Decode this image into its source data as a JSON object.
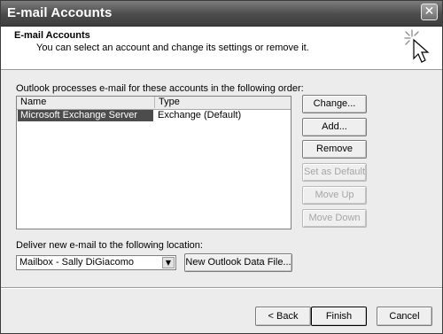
{
  "window": {
    "title": "E-mail Accounts",
    "close_glyph": "✕"
  },
  "header": {
    "title": "E-mail Accounts",
    "description": "You can select an account and change its settings or remove it.",
    "icon": "wizard-sparkle-cursor-icon"
  },
  "accounts": {
    "label": "Outlook processes e-mail for these accounts in the following order:",
    "columns": [
      "Name",
      "Type"
    ],
    "rows": [
      {
        "name": "Microsoft Exchange Server",
        "type": "Exchange (Default)",
        "selected": true
      }
    ]
  },
  "side_buttons": {
    "change": {
      "label": "Change...",
      "enabled": true
    },
    "add": {
      "label": "Add...",
      "enabled": true
    },
    "remove": {
      "label": "Remove",
      "enabled": true
    },
    "set_default": {
      "label": "Set as Default",
      "enabled": false
    },
    "move_up": {
      "label": "Move Up",
      "enabled": false
    },
    "move_down": {
      "label": "Move Down",
      "enabled": false
    }
  },
  "deliver": {
    "label": "Deliver new e-mail to the following location:",
    "selected_value": "Mailbox - Sally DiGiacomo",
    "new_data_file_label": "New Outlook Data File..."
  },
  "footer": {
    "back_label": "< Back",
    "finish_label": "Finish",
    "cancel_label": "Cancel"
  },
  "colors": {
    "selection": "#4c4c4c",
    "disabled_text": "#a6a6a6"
  }
}
